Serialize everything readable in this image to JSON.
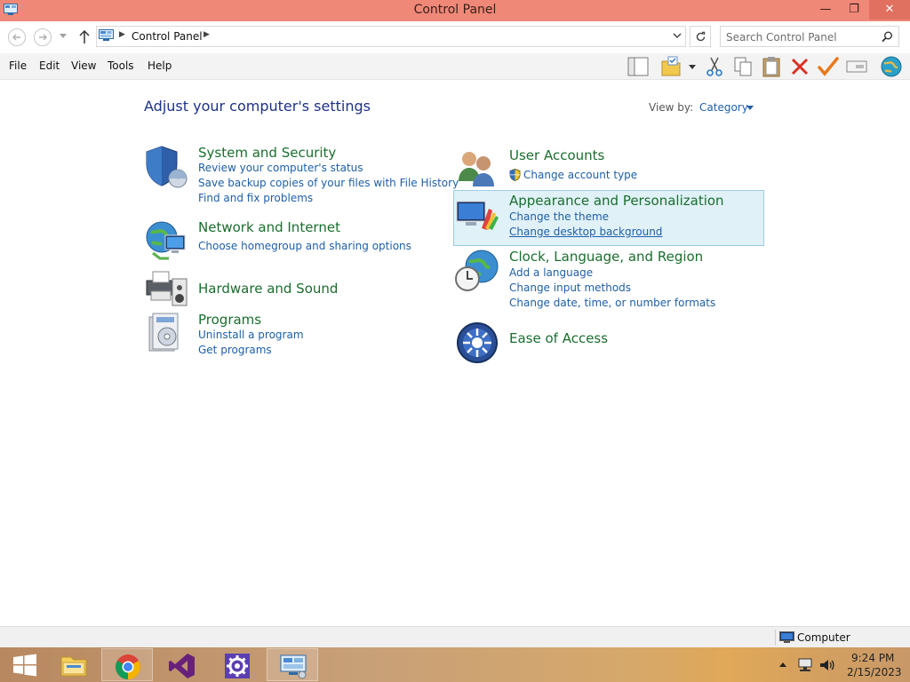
{
  "window": {
    "title": "Control Panel",
    "min_glyph": "—",
    "max_glyph": "❐",
    "close_glyph": "✕"
  },
  "address": {
    "crumb": "Control Panel",
    "separator": "▶",
    "search_placeholder": "Search Control Panel"
  },
  "menu": [
    "File",
    "Edit",
    "View",
    "Tools",
    "Help"
  ],
  "main": {
    "heading": "Adjust your computer's settings",
    "view_by_label": "View by:",
    "view_by_value": "Category"
  },
  "categories": {
    "system": {
      "title": "System and Security",
      "links": [
        "Review your computer's status",
        "Save backup copies of your files with File History",
        "Find and fix problems"
      ]
    },
    "network": {
      "title": "Network and Internet",
      "links": [
        "Choose homegroup and sharing options"
      ]
    },
    "hardware": {
      "title": "Hardware and Sound",
      "links": []
    },
    "programs": {
      "title": "Programs",
      "links": [
        "Uninstall a program",
        "Get programs"
      ]
    },
    "users": {
      "title": "User Accounts",
      "links": [
        "Change account type"
      ]
    },
    "appearance": {
      "title": "Appearance and Personalization",
      "links": [
        "Change the theme",
        "Change desktop background"
      ]
    },
    "clock": {
      "title": "Clock, Language, and Region",
      "links": [
        "Add a language",
        "Change input methods",
        "Change date, time, or number formats"
      ]
    },
    "ease": {
      "title": "Ease of Access",
      "links": []
    }
  },
  "status": {
    "location": "Computer"
  },
  "taskbar": {
    "time": "9:24 PM",
    "date": "2/15/2023",
    "apps": [
      "start-icon",
      "file-explorer-icon",
      "chrome-icon",
      "visual-studio-icon",
      "settings-icon",
      "control-panel-icon"
    ]
  },
  "colors": {
    "titlebar": "#f08878",
    "category_title": "#1a6e2e",
    "link": "#1e5fa8",
    "heading": "#1e3287"
  }
}
